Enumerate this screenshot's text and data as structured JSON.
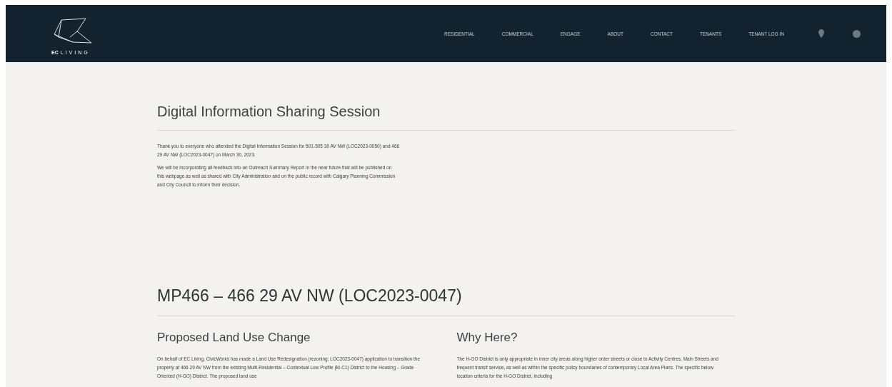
{
  "header": {
    "logo": {
      "brand_bold": "EC",
      "brand_light": "LIVING"
    },
    "nav": [
      {
        "label": "RESIDENTIAL"
      },
      {
        "label": "COMMERCIAL"
      },
      {
        "label": "ENGAGE"
      },
      {
        "label": "ABOUT"
      },
      {
        "label": "CONTACT"
      },
      {
        "label": "TENANTS"
      },
      {
        "label": "TENANT LOG IN"
      }
    ]
  },
  "session": {
    "title": "Digital Information Sharing Session",
    "paragraphs": [
      "Thank you to everyone who attended the Digital Information Session for 501-505 30 AV NW (LOC2023-0050) and 466 29 AV NW (LOC2023-0047) on March 30, 2023.",
      "We will be incorporating all feedback into an Outreach Summary Report in the near future that will be published on this webpage as well as shared with City Administration and on the public record with Calgary Planning Commission and City Council to inform their decision."
    ]
  },
  "project": {
    "title": "MP466 – 466 29 AV NW (LOC2023-0047)",
    "columns": [
      {
        "heading": "Proposed Land Use Change",
        "text": "On behalf of EC Living, CivicWorks has made a Land Use Redesignation (rezoning; LOC2023-0047) application to transition the property at 466 29 AV NW from the existing Multi-Residential – Contextual Low Profile (M-C1) District to the Housing – Grade Oriented (H-GO) District. The proposed land use"
      },
      {
        "heading": "Why Here?",
        "text": "The H-GO District is only appropriate in inner city areas along higher order streets or close to Activity Centres, Main Streets and frequent transit service, as well as within the specific policy boundaries of contemporary Local Area Plans. The specific below location criteria for the H-GO District, including"
      }
    ]
  }
}
